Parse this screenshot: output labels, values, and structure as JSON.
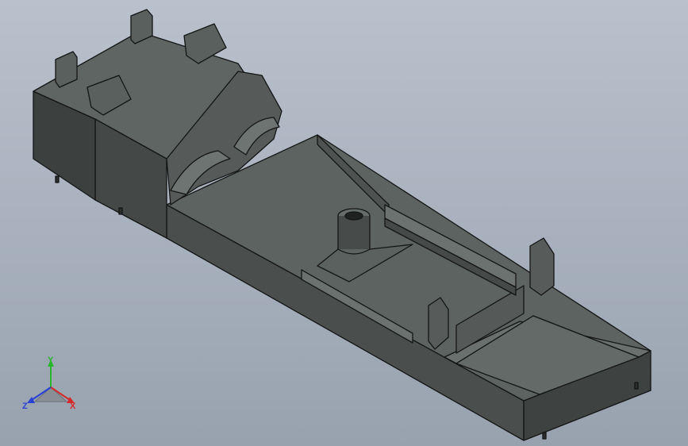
{
  "viewport": {
    "background_top": "#b9c1cc",
    "background_bottom": "#98a2af"
  },
  "model": {
    "body_color": "#505553",
    "top_face_color": "#626866",
    "dark_face_color": "#3a3e3d",
    "edge_color": "#141515"
  },
  "triad": {
    "x_label": "X",
    "y_label": "Y",
    "z_label": "Z",
    "x_color": "#d42a2a",
    "y_color": "#2ab52a",
    "z_color": "#2a3fd4"
  }
}
